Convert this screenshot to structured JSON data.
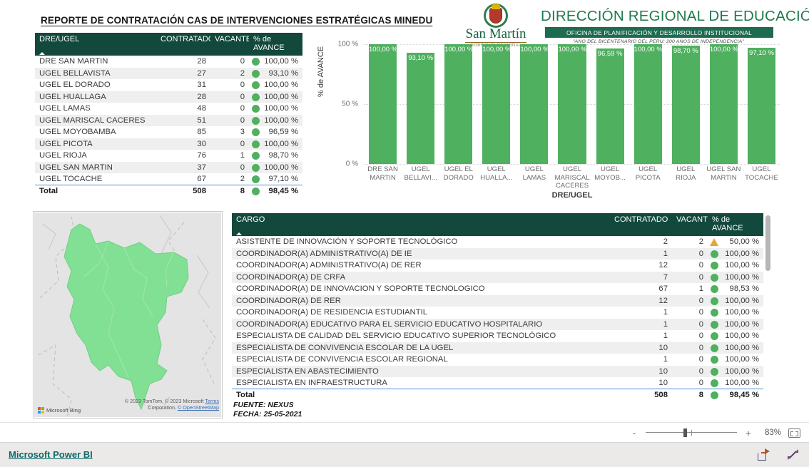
{
  "report": {
    "title": "REPORTE DE CONTRATACIÓN CAS DE INTERVENCIONES ESTRATÉGICAS MINEDU"
  },
  "header": {
    "brand_name": "San Martín",
    "brand_sub": "GOBIERNO REGIONAL",
    "org_title": "DIRECCIÓN REGIONAL DE EDUCACIÓN",
    "org_band": "OFICINA DE PLANIFICACIÓN Y DESARROLLO INSTITUCIONAL",
    "org_footer": "\"AÑO DEL BICENTENARIO DEL PERÚ: 200 AÑOS DE INDEPENDENCIA\""
  },
  "ugel_table": {
    "columns": [
      "DRE/UGEL",
      "CONTRATADO",
      "VACANTE",
      "% de AVANCE"
    ],
    "rows": [
      {
        "name": "DRE SAN MARTIN",
        "contratado": "28",
        "vacante": "0",
        "avance": "100,00 %",
        "status": "ok"
      },
      {
        "name": "UGEL BELLAVISTA",
        "contratado": "27",
        "vacante": "2",
        "avance": "93,10 %",
        "status": "ok"
      },
      {
        "name": "UGEL EL DORADO",
        "contratado": "31",
        "vacante": "0",
        "avance": "100,00 %",
        "status": "ok"
      },
      {
        "name": "UGEL HUALLAGA",
        "contratado": "28",
        "vacante": "0",
        "avance": "100,00 %",
        "status": "ok"
      },
      {
        "name": "UGEL LAMAS",
        "contratado": "48",
        "vacante": "0",
        "avance": "100,00 %",
        "status": "ok"
      },
      {
        "name": "UGEL MARISCAL CACERES",
        "contratado": "51",
        "vacante": "0",
        "avance": "100,00 %",
        "status": "ok"
      },
      {
        "name": "UGEL MOYOBAMBA",
        "contratado": "85",
        "vacante": "3",
        "avance": "96,59 %",
        "status": "ok"
      },
      {
        "name": "UGEL PICOTA",
        "contratado": "30",
        "vacante": "0",
        "avance": "100,00 %",
        "status": "ok"
      },
      {
        "name": "UGEL RIOJA",
        "contratado": "76",
        "vacante": "1",
        "avance": "98,70 %",
        "status": "ok"
      },
      {
        "name": "UGEL SAN MARTIN",
        "contratado": "37",
        "vacante": "0",
        "avance": "100,00 %",
        "status": "ok"
      },
      {
        "name": "UGEL TOCACHE",
        "contratado": "67",
        "vacante": "2",
        "avance": "97,10 %",
        "status": "ok"
      }
    ],
    "total": {
      "name": "Total",
      "contratado": "508",
      "vacante": "8",
      "avance": "98,45 %",
      "status": "ok"
    }
  },
  "chart_data": {
    "type": "bar",
    "title": "",
    "xlabel": "DRE/UGEL",
    "ylabel": "% de AVANCE",
    "ylim": [
      0,
      100
    ],
    "ytick_labels": [
      "0 %",
      "50 %",
      "100 %"
    ],
    "ytick_values": [
      0,
      50,
      100
    ],
    "grid": true,
    "legend": "none",
    "categories": [
      "DRE SAN MARTIN",
      "UGEL BELLAVI...",
      "UGEL EL DORADO",
      "UGEL HUALLA...",
      "UGEL LAMAS",
      "UGEL MARISCAL CACERES",
      "UGEL MOYOB...",
      "UGEL PICOTA",
      "UGEL RIOJA",
      "UGEL SAN MARTIN",
      "UGEL TOCACHE"
    ],
    "values": [
      100.0,
      93.1,
      100.0,
      100.0,
      100.0,
      100.0,
      96.59,
      100.0,
      98.7,
      100.0,
      97.1
    ],
    "data_labels": [
      "100,00 %",
      "93,10 %",
      "100,00 %",
      "100,00 %",
      "100,00 %",
      "100,00 %",
      "96,59 %",
      "100,00 %",
      "98,70 %",
      "100,00 %",
      "97,10 %"
    ],
    "bar_color": "#4fb05f"
  },
  "map": {
    "region_color": "#82e095",
    "background_color": "#e4e4e4",
    "brand": "Microsoft Bing",
    "credit_line1": "© 2023 TomTom, © 2023 Microsoft",
    "credit_line2": "Corporation,",
    "credit_terms": "Terms",
    "credit_osm": "© OpenStreetMap"
  },
  "cargo_table": {
    "columns": [
      "CARGO",
      "CONTRATADO",
      "VACANTE",
      "% de AVANCE"
    ],
    "rows": [
      {
        "name": "ASISTENTE DE INNOVACIÓN Y SOPORTE TECNOLÓGICO",
        "contratado": "2",
        "vacante": "2",
        "avance": "50,00 %",
        "status": "warn"
      },
      {
        "name": "COORDINADOR(A) ADMINISTRATIVO(A) DE IE",
        "contratado": "1",
        "vacante": "0",
        "avance": "100,00 %",
        "status": "ok"
      },
      {
        "name": "COORDINADOR(A) ADMINISTRATIVO(A) DE RER",
        "contratado": "12",
        "vacante": "0",
        "avance": "100,00 %",
        "status": "ok"
      },
      {
        "name": "COORDINADOR(A) DE CRFA",
        "contratado": "7",
        "vacante": "0",
        "avance": "100,00 %",
        "status": "ok"
      },
      {
        "name": "COORDINADOR(A) DE INNOVACION Y SOPORTE TECNOLOGICO",
        "contratado": "67",
        "vacante": "1",
        "avance": "98,53 %",
        "status": "ok"
      },
      {
        "name": "COORDINADOR(A) DE RER",
        "contratado": "12",
        "vacante": "0",
        "avance": "100,00 %",
        "status": "ok"
      },
      {
        "name": "COORDINADOR(A) DE RESIDENCIA ESTUDIANTIL",
        "contratado": "1",
        "vacante": "0",
        "avance": "100,00 %",
        "status": "ok"
      },
      {
        "name": "COORDINADOR(A) EDUCATIVO PARA EL SERVICIO EDUCATIVO HOSPITALARIO",
        "contratado": "1",
        "vacante": "0",
        "avance": "100,00 %",
        "status": "ok"
      },
      {
        "name": "ESPECIALISTA DE CALIDAD DEL SERVICIO EDUCATIVO SUPERIOR TECNOLÓGICO",
        "contratado": "1",
        "vacante": "0",
        "avance": "100,00 %",
        "status": "ok"
      },
      {
        "name": "ESPECIALISTA DE CONVIVENCIA ESCOLAR DE LA UGEL",
        "contratado": "10",
        "vacante": "0",
        "avance": "100,00 %",
        "status": "ok"
      },
      {
        "name": "ESPECIALISTA DE CONVIVENCIA ESCOLAR REGIONAL",
        "contratado": "1",
        "vacante": "0",
        "avance": "100,00 %",
        "status": "ok"
      },
      {
        "name": "ESPECIALISTA EN ABASTECIMIENTO",
        "contratado": "10",
        "vacante": "0",
        "avance": "100,00 %",
        "status": "ok"
      },
      {
        "name": "ESPECIALISTA EN INFRAESTRUCTURA",
        "contratado": "10",
        "vacante": "0",
        "avance": "100,00 %",
        "status": "ok"
      }
    ],
    "total": {
      "name": "Total",
      "contratado": "508",
      "vacante": "8",
      "avance": "98,45 %",
      "status": "ok"
    }
  },
  "footer_note": {
    "source": "FUENTE: NEXUS",
    "date": "FECHA: 25-05-2021"
  },
  "zoom_bar": {
    "minus": "-",
    "plus": "+",
    "percent": "83%"
  },
  "powerbi_bar": {
    "link": "Microsoft Power BI"
  }
}
